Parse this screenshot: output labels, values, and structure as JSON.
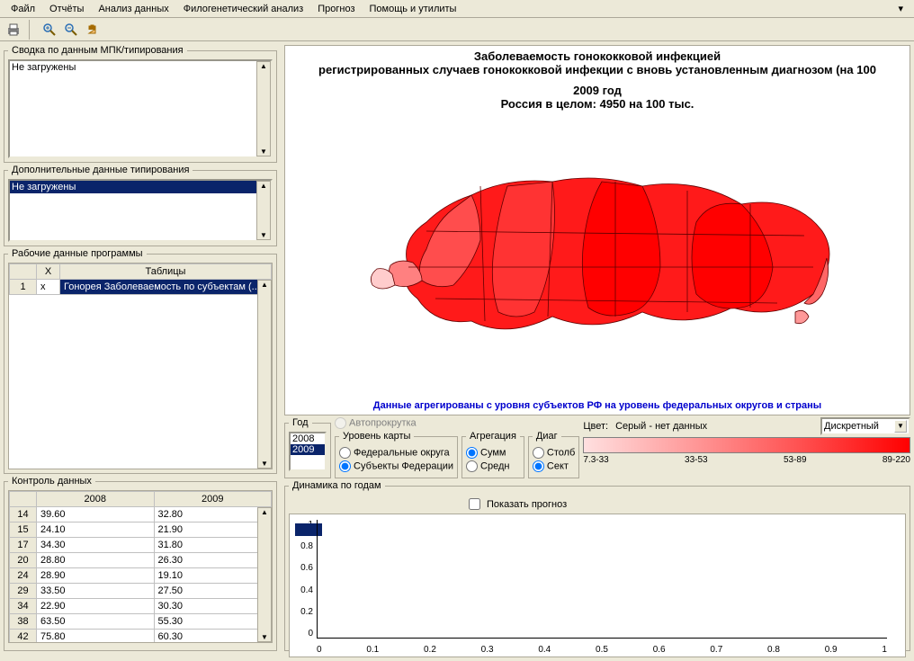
{
  "menu": {
    "file": "Файл",
    "reports": "Отчёты",
    "analysis": "Анализ данных",
    "phylo": "Филогенетический анализ",
    "prognosis": "Прогноз",
    "help": "Помощь и утилиты"
  },
  "panels": {
    "mpk_title": "Сводка по данным МПК/типирования",
    "mpk_item": "Не загружены",
    "extra_title": "Дополнительные данные типирования",
    "extra_item": "Не загружены",
    "work_title": "Рабочие данные программы",
    "work_cols": {
      "x": "X",
      "tables": "Таблицы"
    },
    "work_row": {
      "n": "1",
      "x": "x",
      "name": "Гонорея Заболеваемость по субъектам (..."
    },
    "control_title": "Контроль данных"
  },
  "control_table": {
    "cols": [
      "",
      "2008",
      "2009"
    ],
    "rows": [
      [
        "14",
        "39.60",
        "32.80"
      ],
      [
        "15",
        "24.10",
        "21.90"
      ],
      [
        "17",
        "34.30",
        "31.80"
      ],
      [
        "20",
        "28.80",
        "26.30"
      ],
      [
        "24",
        "28.90",
        "19.10"
      ],
      [
        "29",
        "33.50",
        "27.50"
      ],
      [
        "34",
        "22.90",
        "30.30"
      ],
      [
        "38",
        "63.50",
        "55.30"
      ],
      [
        "42",
        "75.80",
        "60.30"
      ]
    ]
  },
  "map": {
    "title": "Заболеваемость гонококковой инфекцией",
    "subtitle": "регистрированных случаев гонококковой инфекции с вновь установленным диагнозом (на 100",
    "year_line": "2009 год",
    "total_line": "Россия в целом: 4950 на 100 тыс.",
    "note": "Данные агрегированы с уровня субъектов РФ на уровень федеральных округов и страны"
  },
  "controls": {
    "year_label": "Год",
    "years": [
      "2008",
      "2009"
    ],
    "selected_year": "2009",
    "autoscroll": "Автопрокрутка",
    "level_label": "Уровень карты",
    "level_federal": "Федеральные округа",
    "level_subjects": "Субъекты Федерации",
    "aggr_label": "Агрегация",
    "aggr_sum": "Сумм",
    "aggr_avg": "Средн",
    "diag_label": "Диаг",
    "diag_col": "Столб",
    "diag_sect": "Сект",
    "color_label": "Цвет:",
    "color_grey": "Серый - нет данных",
    "color_mode": "Дискретный",
    "scale": [
      "7.3-33",
      "33-53",
      "53-89",
      "89-220"
    ]
  },
  "dynamics": {
    "title": "Динамика по годам",
    "show_forecast": "Показать прогноз"
  },
  "chart_data": {
    "type": "line",
    "title": "Динамика по годам",
    "xlabel": "",
    "ylabel": "",
    "xlim": [
      0,
      1
    ],
    "ylim": [
      0,
      1
    ],
    "x_ticks": [
      0,
      0.1,
      0.2,
      0.3,
      0.4,
      0.5,
      0.6,
      0.7,
      0.8,
      0.9,
      1
    ],
    "y_ticks": [
      0,
      0.2,
      0.4,
      0.6,
      0.8,
      1
    ],
    "series": []
  }
}
